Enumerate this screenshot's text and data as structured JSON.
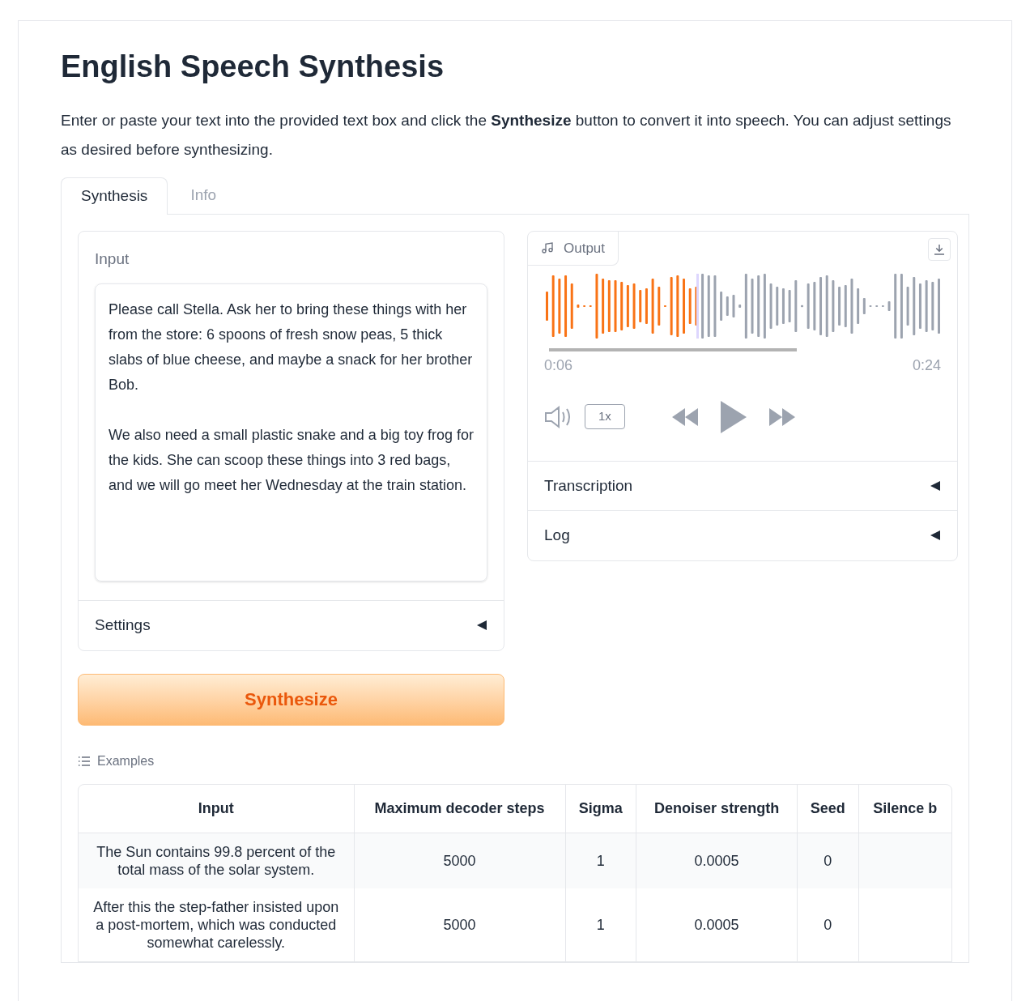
{
  "title": "English Speech Synthesis",
  "description": "Enter or paste your text into the provided text box and click the **Synthesize** button to convert it into speech. You can adjust settings as desired before synthesizing.",
  "tabs": [
    {
      "label": "Synthesis",
      "selected": true
    },
    {
      "label": "Info",
      "selected": false
    }
  ],
  "input": {
    "label": "Input",
    "value": "Please call Stella. Ask her to bring these things with her from the store: 6 spoons of fresh snow peas, 5 thick slabs of blue cheese, and maybe a snack for her brother Bob.\n\nWe also need a small plastic snake and a big toy frog for the kids. She can scoop these things into 3 red bags, and we will go meet her Wednesday at the train station."
  },
  "settings": {
    "label": "Settings",
    "expanded": false
  },
  "synthesize_button": "Synthesize",
  "output": {
    "label": "Output",
    "level": 0.39,
    "current_time": "0:06",
    "duration": "0:24",
    "speed": "1x"
  },
  "accordions": [
    {
      "label": "Transcription",
      "expanded": false
    },
    {
      "label": "Log",
      "expanded": false
    }
  ],
  "examples": {
    "label": "Examples",
    "columns": [
      "Input",
      "Maximum decoder steps",
      "Sigma",
      "Denoiser strength",
      "Seed",
      "Silence b"
    ],
    "rows": [
      [
        "The Sun contains 99.8 percent of the total mass of the solar system.",
        "5000",
        "1",
        "0.0005",
        "0",
        ""
      ],
      [
        "After this the step-father insisted upon a post-mortem, which was conducted somewhat carelessly.",
        "5000",
        "1",
        "0.0005",
        "0",
        ""
      ]
    ]
  }
}
